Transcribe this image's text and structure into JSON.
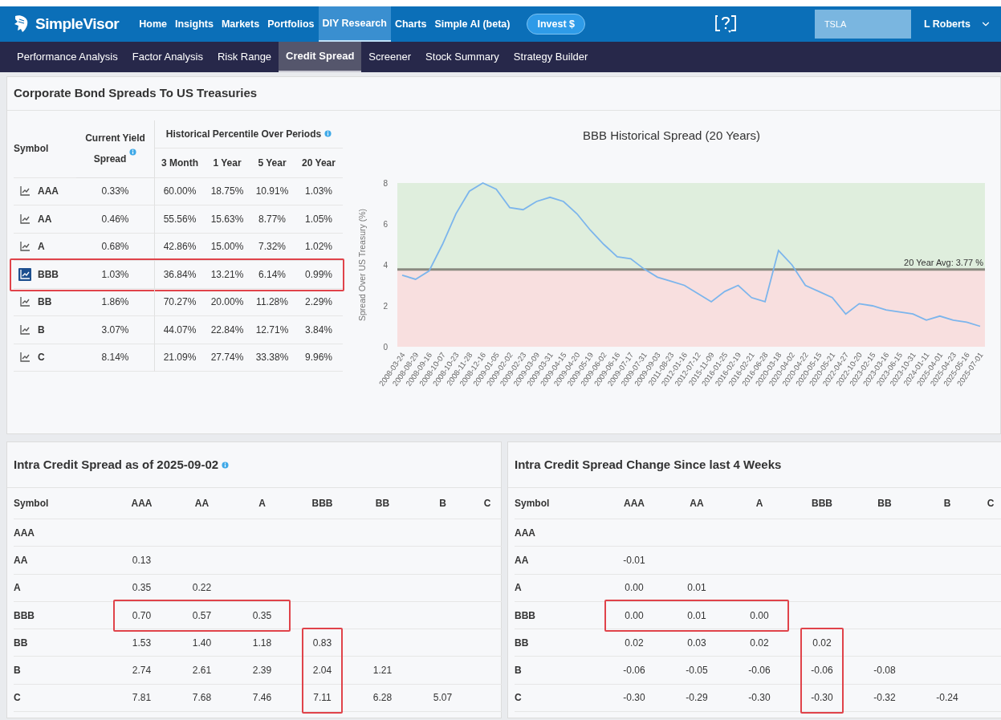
{
  "nav": {
    "logo": "SimpleVisor",
    "items": [
      {
        "label": "Home",
        "selected": false
      },
      {
        "label": "Insights",
        "selected": false
      },
      {
        "label": "Markets",
        "selected": false
      },
      {
        "label": "Portfolios",
        "selected": false
      },
      {
        "label": "DIY Research",
        "selected": true
      },
      {
        "label": "Charts",
        "selected": false
      },
      {
        "label": "Simple AI (beta)",
        "selected": false
      }
    ],
    "invest_button": "Invest $",
    "search": {
      "value": "TSLA"
    },
    "user": "L Roberts"
  },
  "subnav": {
    "items": [
      {
        "label": "Performance Analysis",
        "selected": false
      },
      {
        "label": "Factor Analysis",
        "selected": false
      },
      {
        "label": "Risk Range",
        "selected": false
      },
      {
        "label": "Credit Spread",
        "selected": true
      },
      {
        "label": "Screener",
        "selected": false
      },
      {
        "label": "Stock Summary",
        "selected": false
      },
      {
        "label": "Strategy Builder",
        "selected": false
      }
    ]
  },
  "bond_spreads": {
    "title": "Corporate Bond Spreads To US Treasuries",
    "columns": {
      "symbol": "Symbol",
      "current": "Current Yield Spread",
      "group": "Historical Percentile Over Periods",
      "periods": [
        "3 Month",
        "1 Year",
        "5 Year",
        "20 Year"
      ]
    },
    "rows": [
      {
        "symbol": "AAA",
        "spread": "0.33%",
        "percentiles": [
          "60.00%",
          "18.75%",
          "10.91%",
          "1.03%"
        ],
        "selected": false,
        "marked": false
      },
      {
        "symbol": "AA",
        "spread": "0.46%",
        "percentiles": [
          "55.56%",
          "15.63%",
          "8.77%",
          "1.05%"
        ],
        "selected": false,
        "marked": false
      },
      {
        "symbol": "A",
        "spread": "0.68%",
        "percentiles": [
          "42.86%",
          "15.00%",
          "7.32%",
          "1.02%"
        ],
        "selected": false,
        "marked": false
      },
      {
        "symbol": "BBB",
        "spread": "1.03%",
        "percentiles": [
          "36.84%",
          "13.21%",
          "6.14%",
          "0.99%"
        ],
        "selected": true,
        "marked": true
      },
      {
        "symbol": "BB",
        "spread": "1.86%",
        "percentiles": [
          "70.27%",
          "20.00%",
          "11.28%",
          "2.29%"
        ],
        "selected": false,
        "marked": false
      },
      {
        "symbol": "B",
        "spread": "3.07%",
        "percentiles": [
          "44.07%",
          "22.84%",
          "12.71%",
          "3.84%"
        ],
        "selected": false,
        "marked": false
      },
      {
        "symbol": "C",
        "spread": "8.14%",
        "percentiles": [
          "21.09%",
          "27.74%",
          "33.38%",
          "9.96%"
        ],
        "selected": false,
        "marked": false
      }
    ],
    "chart_data": {
      "type": "line",
      "title": "BBB Historical Spread (20 Years)",
      "ylabel": "Spread Over US Treasury (%)",
      "categories": [
        "2008-03-24",
        "2008-08-29",
        "2008-09-16",
        "2008-10-07",
        "2008-10-23",
        "2008-11-28",
        "2008-12-16",
        "2009-01-05",
        "2009-02-02",
        "2009-02-23",
        "2009-03-09",
        "2009-03-31",
        "2009-04-15",
        "2009-04-20",
        "2009-05-19",
        "2009-06-02",
        "2009-06-16",
        "2009-07-17",
        "2009-07-31",
        "2009-09-03",
        "2011-08-23",
        "2012-01-16",
        "2012-07-12",
        "2015-11-09",
        "2016-01-25",
        "2016-02-19",
        "2016-02-21",
        "2016-06-28",
        "2020-03-18",
        "2020-04-02",
        "2020-04-22",
        "2020-05-15",
        "2020-05-21",
        "2022-04-27",
        "2022-10-20",
        "2023-02-15",
        "2023-03-16",
        "2023-06-15",
        "2023-10-31",
        "2024-01-11",
        "2025-04-01",
        "2025-04-23",
        "2025-05-16",
        "2025-07-01"
      ],
      "values": [
        3.5,
        3.3,
        3.7,
        5.0,
        6.5,
        7.6,
        8.0,
        7.7,
        6.8,
        6.7,
        7.1,
        7.3,
        7.1,
        6.5,
        5.7,
        5.0,
        4.4,
        4.3,
        3.8,
        3.4,
        3.2,
        3.0,
        2.6,
        2.2,
        2.7,
        3.0,
        2.4,
        2.2,
        4.7,
        4.0,
        3.0,
        2.7,
        2.4,
        1.6,
        2.1,
        2.0,
        1.8,
        1.7,
        1.6,
        1.3,
        1.5,
        1.3,
        1.2,
        1.0
      ],
      "ylim": [
        0,
        8
      ],
      "yticks": [
        0,
        2,
        4,
        6,
        8
      ],
      "ref_lines": [
        {
          "axis": "y",
          "value": 3.77,
          "label": "20 Year Avg: 3.77 %",
          "color": "#8a8a80"
        }
      ],
      "bands": [
        {
          "axis": "y",
          "from": 3.77,
          "to": 8,
          "color": "#dfeedd"
        },
        {
          "axis": "y",
          "from": 0,
          "to": 3.77,
          "color": "#f8dfdf"
        }
      ]
    }
  },
  "intra_spread": {
    "title": "Intra Credit Spread as of 2025-09-02",
    "info_icon": true,
    "columns": [
      "Symbol",
      "AAA",
      "AA",
      "A",
      "BBB",
      "BB",
      "B",
      "C"
    ],
    "rows": [
      {
        "symbol": "AAA"
      },
      {
        "symbol": "AA",
        "cells": [
          {
            "value": "0.13",
            "marked": false
          }
        ]
      },
      {
        "symbol": "A",
        "cells": [
          {
            "value": "0.35",
            "marked": false
          },
          {
            "value": "0.22",
            "marked": false
          }
        ]
      },
      {
        "symbol": "BBB",
        "cells": [
          {
            "value": "0.70",
            "marked": true
          },
          {
            "value": "0.57",
            "marked": true
          },
          {
            "value": "0.35",
            "marked": true
          }
        ]
      },
      {
        "symbol": "BB",
        "cells": [
          {
            "value": "1.53",
            "marked": false
          },
          {
            "value": "1.40",
            "marked": false
          },
          {
            "value": "1.18",
            "marked": false
          },
          {
            "value": "0.83",
            "marked": true
          }
        ]
      },
      {
        "symbol": "B",
        "cells": [
          {
            "value": "2.74",
            "marked": false
          },
          {
            "value": "2.61",
            "marked": false
          },
          {
            "value": "2.39",
            "marked": false
          },
          {
            "value": "2.04",
            "marked": true
          },
          {
            "value": "1.21",
            "marked": false
          }
        ]
      },
      {
        "symbol": "C",
        "cells": [
          {
            "value": "7.81",
            "marked": false
          },
          {
            "value": "7.68",
            "marked": false
          },
          {
            "value": "7.46",
            "marked": false
          },
          {
            "value": "7.11",
            "marked": true
          },
          {
            "value": "6.28",
            "marked": false
          },
          {
            "value": "5.07",
            "marked": false
          }
        ]
      }
    ]
  },
  "spread_change": {
    "title": "Intra Credit Spread Change Since last 4 Weeks",
    "info_icon": false,
    "columns": [
      "Symbol",
      "AAA",
      "AA",
      "A",
      "BBB",
      "BB",
      "B",
      "C"
    ],
    "rows": [
      {
        "symbol": "AAA"
      },
      {
        "symbol": "AA",
        "cells": [
          {
            "value": "-0.01",
            "marked": false
          }
        ]
      },
      {
        "symbol": "A",
        "cells": [
          {
            "value": "0.00",
            "marked": false
          },
          {
            "value": "0.01",
            "marked": false
          }
        ]
      },
      {
        "symbol": "BBB",
        "cells": [
          {
            "value": "0.00",
            "marked": true
          },
          {
            "value": "0.01",
            "marked": true
          },
          {
            "value": "0.00",
            "marked": true
          }
        ]
      },
      {
        "symbol": "BB",
        "cells": [
          {
            "value": "0.02",
            "marked": false
          },
          {
            "value": "0.03",
            "marked": false
          },
          {
            "value": "0.02",
            "marked": false
          },
          {
            "value": "0.02",
            "marked": true
          }
        ]
      },
      {
        "symbol": "B",
        "cells": [
          {
            "value": "-0.06",
            "marked": false
          },
          {
            "value": "-0.05",
            "marked": false
          },
          {
            "value": "-0.06",
            "marked": false
          },
          {
            "value": "-0.06",
            "marked": true
          },
          {
            "value": "-0.08",
            "marked": false
          }
        ]
      },
      {
        "symbol": "C",
        "cells": [
          {
            "value": "-0.30",
            "marked": false
          },
          {
            "value": "-0.29",
            "marked": false
          },
          {
            "value": "-0.30",
            "marked": false
          },
          {
            "value": "-0.30",
            "marked": true
          },
          {
            "value": "-0.32",
            "marked": false
          },
          {
            "value": "-0.24",
            "marked": false
          }
        ]
      }
    ]
  }
}
